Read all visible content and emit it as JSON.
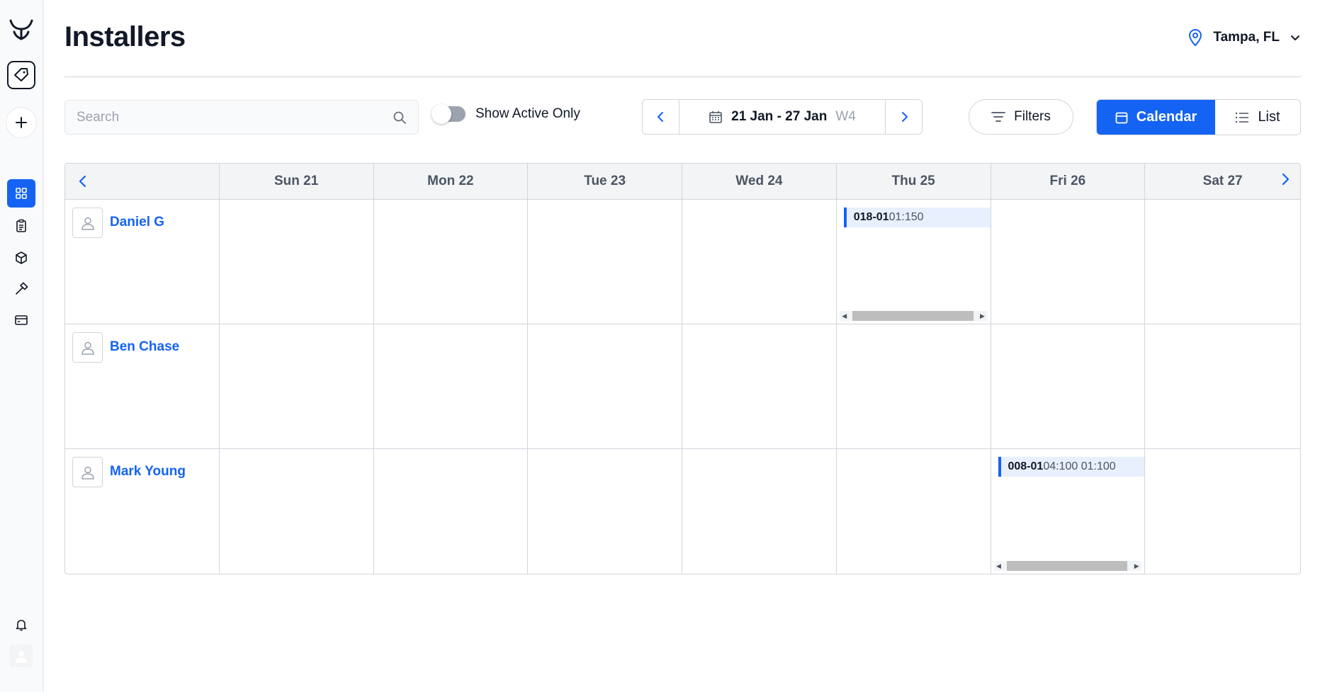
{
  "page": {
    "title": "Installers"
  },
  "location": {
    "label": "Tampa, FL"
  },
  "search": {
    "placeholder": "Search"
  },
  "toggle": {
    "label": "Show Active Only"
  },
  "date_nav": {
    "range": "21 Jan - 27 Jan",
    "week": "W4"
  },
  "filters": {
    "label": "Filters"
  },
  "view": {
    "calendar_label": "Calendar",
    "list_label": "List"
  },
  "calendar": {
    "days": [
      "Sun 21",
      "Mon 22",
      "Tue 23",
      "Wed 24",
      "Thu 25",
      "Fri 26",
      "Sat 27"
    ],
    "installers": [
      {
        "name": "Daniel G"
      },
      {
        "name": "Ben Chase"
      },
      {
        "name": "Mark Young"
      }
    ],
    "events": [
      {
        "code": "018-01",
        "extra": "01:150"
      },
      {
        "code": "008-01",
        "extra": "04:100 01:100"
      }
    ]
  },
  "colors": {
    "accent": "#1463f3",
    "event_bg": "#e8f0fe"
  }
}
